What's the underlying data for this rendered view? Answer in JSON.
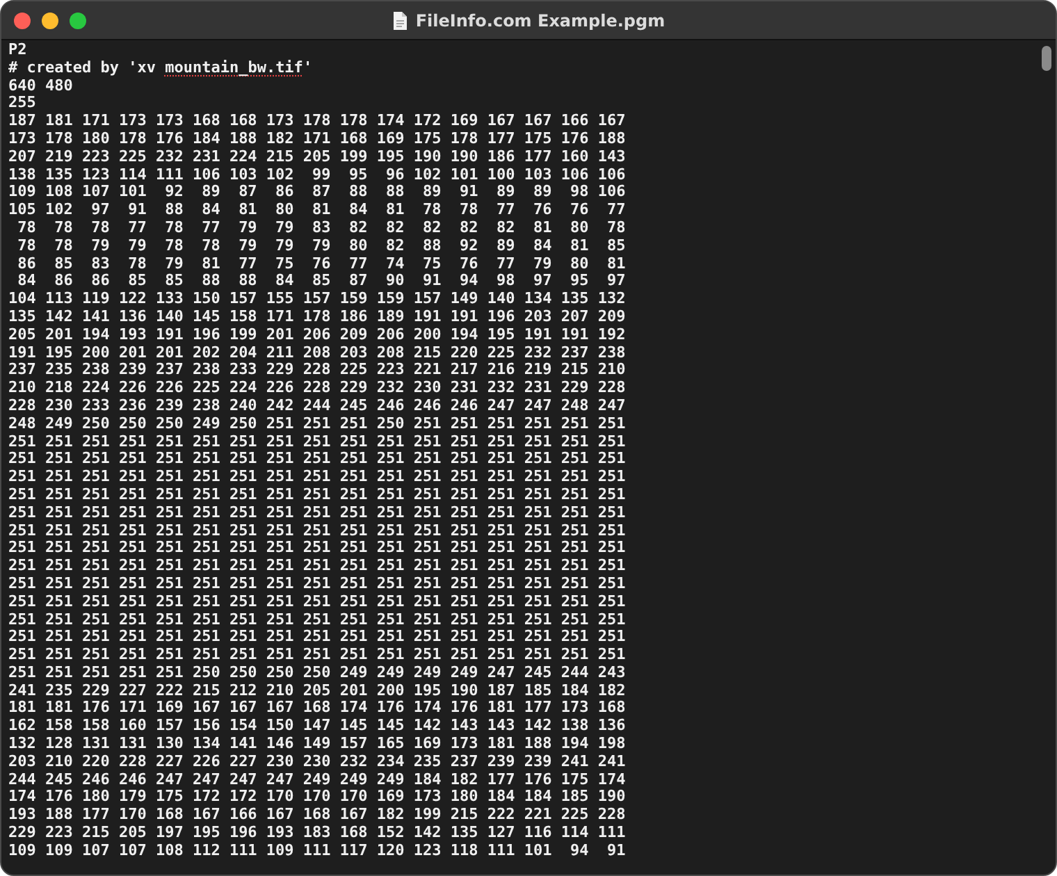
{
  "window": {
    "title": "FileInfo.com Example.pgm"
  },
  "document": {
    "lines": [
      {
        "kind": "plain",
        "text": "P2"
      },
      {
        "kind": "spellchecked",
        "segments": [
          {
            "text": "# created by 'xv ",
            "misspelled": false
          },
          {
            "text": "mountain_bw.tif",
            "misspelled": true
          },
          {
            "text": "'",
            "misspelled": false
          }
        ]
      },
      {
        "kind": "plain",
        "text": "640 480"
      },
      {
        "kind": "plain",
        "text": "255"
      },
      {
        "kind": "plain",
        "text": "187 181 171 173 173 168 168 173 178 178 174 172 169 167 167 166 167"
      },
      {
        "kind": "plain",
        "text": "173 178 180 178 176 184 188 182 171 168 169 175 178 177 175 176 188"
      },
      {
        "kind": "plain",
        "text": "207 219 223 225 232 231 224 215 205 199 195 190 190 186 177 160 143"
      },
      {
        "kind": "plain",
        "text": "138 135 123 114 111 106 103 102  99  95  96 102 101 100 103 106 106"
      },
      {
        "kind": "plain",
        "text": "109 108 107 101  92  89  87  86  87  88  88  89  91  89  89  98 106"
      },
      {
        "kind": "plain",
        "text": "105 102  97  91  88  84  81  80  81  84  81  78  78  77  76  76  77"
      },
      {
        "kind": "plain",
        "text": " 78  78  78  77  78  77  79  79  83  82  82  82  82  82  81  80  78"
      },
      {
        "kind": "plain",
        "text": " 78  78  79  79  78  78  79  79  79  80  82  88  92  89  84  81  85"
      },
      {
        "kind": "plain",
        "text": " 86  85  83  78  79  81  77  75  76  77  74  75  76  77  79  80  81"
      },
      {
        "kind": "plain",
        "text": " 84  86  86  85  85  88  88  84  85  87  90  91  94  98  97  95  97"
      },
      {
        "kind": "plain",
        "text": "104 113 119 122 133 150 157 155 157 159 159 157 149 140 134 135 132"
      },
      {
        "kind": "plain",
        "text": "135 142 141 136 140 145 158 171 178 186 189 191 191 196 203 207 209"
      },
      {
        "kind": "plain",
        "text": "205 201 194 193 191 196 199 201 206 209 206 200 194 195 191 191 192"
      },
      {
        "kind": "plain",
        "text": "191 195 200 201 201 202 204 211 208 203 208 215 220 225 232 237 238"
      },
      {
        "kind": "plain",
        "text": "237 235 238 239 237 238 233 229 228 225 223 221 217 216 219 215 210"
      },
      {
        "kind": "plain",
        "text": "210 218 224 226 226 225 224 226 228 229 232 230 231 232 231 229 228"
      },
      {
        "kind": "plain",
        "text": "228 230 233 236 239 238 240 242 244 245 246 246 246 247 247 248 247"
      },
      {
        "kind": "plain",
        "text": "248 249 250 250 250 249 250 251 251 251 250 251 251 251 251 251 251"
      },
      {
        "kind": "plain",
        "text": "251 251 251 251 251 251 251 251 251 251 251 251 251 251 251 251 251"
      },
      {
        "kind": "plain",
        "text": "251 251 251 251 251 251 251 251 251 251 251 251 251 251 251 251 251"
      },
      {
        "kind": "plain",
        "text": "251 251 251 251 251 251 251 251 251 251 251 251 251 251 251 251 251"
      },
      {
        "kind": "plain",
        "text": "251 251 251 251 251 251 251 251 251 251 251 251 251 251 251 251 251"
      },
      {
        "kind": "plain",
        "text": "251 251 251 251 251 251 251 251 251 251 251 251 251 251 251 251 251"
      },
      {
        "kind": "plain",
        "text": "251 251 251 251 251 251 251 251 251 251 251 251 251 251 251 251 251"
      },
      {
        "kind": "plain",
        "text": "251 251 251 251 251 251 251 251 251 251 251 251 251 251 251 251 251"
      },
      {
        "kind": "plain",
        "text": "251 251 251 251 251 251 251 251 251 251 251 251 251 251 251 251 251"
      },
      {
        "kind": "plain",
        "text": "251 251 251 251 251 251 251 251 251 251 251 251 251 251 251 251 251"
      },
      {
        "kind": "plain",
        "text": "251 251 251 251 251 251 251 251 251 251 251 251 251 251 251 251 251"
      },
      {
        "kind": "plain",
        "text": "251 251 251 251 251 251 251 251 251 251 251 251 251 251 251 251 251"
      },
      {
        "kind": "plain",
        "text": "251 251 251 251 251 251 251 251 251 251 251 251 251 251 251 251 251"
      },
      {
        "kind": "plain",
        "text": "251 251 251 251 251 251 251 251 251 251 251 251 251 251 251 251 251"
      },
      {
        "kind": "plain",
        "text": "251 251 251 251 251 250 250 250 250 249 249 249 249 247 245 244 243"
      },
      {
        "kind": "plain",
        "text": "241 235 229 227 222 215 212 210 205 201 200 195 190 187 185 184 182"
      },
      {
        "kind": "plain",
        "text": "181 181 176 171 169 167 167 167 168 174 176 174 176 181 177 173 168"
      },
      {
        "kind": "plain",
        "text": "162 158 158 160 157 156 154 150 147 145 145 142 143 143 142 138 136"
      },
      {
        "kind": "plain",
        "text": "132 128 131 131 130 134 141 146 149 157 165 169 173 181 188 194 198"
      },
      {
        "kind": "plain",
        "text": "203 210 220 228 227 226 227 230 230 232 234 235 237 239 239 241 241"
      },
      {
        "kind": "plain",
        "text": "244 245 246 246 247 247 247 247 249 249 249 184 182 177 176 175 174"
      },
      {
        "kind": "plain",
        "text": "174 176 180 179 175 172 172 170 170 170 169 173 180 184 184 185 190"
      },
      {
        "kind": "plain",
        "text": "193 188 177 170 168 167 166 167 168 167 182 199 215 222 221 225 228"
      },
      {
        "kind": "plain",
        "text": "229 223 215 205 197 195 196 193 183 168 152 142 135 127 116 114 111"
      },
      {
        "kind": "plain",
        "text": "109 109 107 107 108 112 111 109 111 117 120 123 118 111 101  94  91"
      }
    ]
  }
}
